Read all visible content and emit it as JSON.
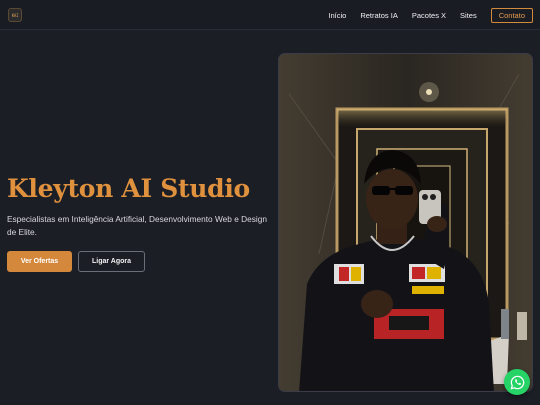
{
  "nav": {
    "logo_text": "KAI",
    "links": [
      "Início",
      "Retratos IA",
      "Pacotes X",
      "Sites"
    ],
    "contact_label": "Contato"
  },
  "hero": {
    "title": "Kleyton AI Studio",
    "subtitle": "Especialistas em Inteligência Artificial, Desenvolvimento Web e Design de Elite.",
    "primary_label": "Ver Ofertas",
    "secondary_label": "Ligar Agora"
  },
  "photo": {
    "alt": "Retrato em espelho de banheiro com jaqueta de corrida"
  },
  "floating": {
    "icon": "whatsapp-icon"
  },
  "colors": {
    "background": "#1c1e26",
    "accent": "#d4883c",
    "title": "#e0913e",
    "whatsapp": "#25d366"
  }
}
